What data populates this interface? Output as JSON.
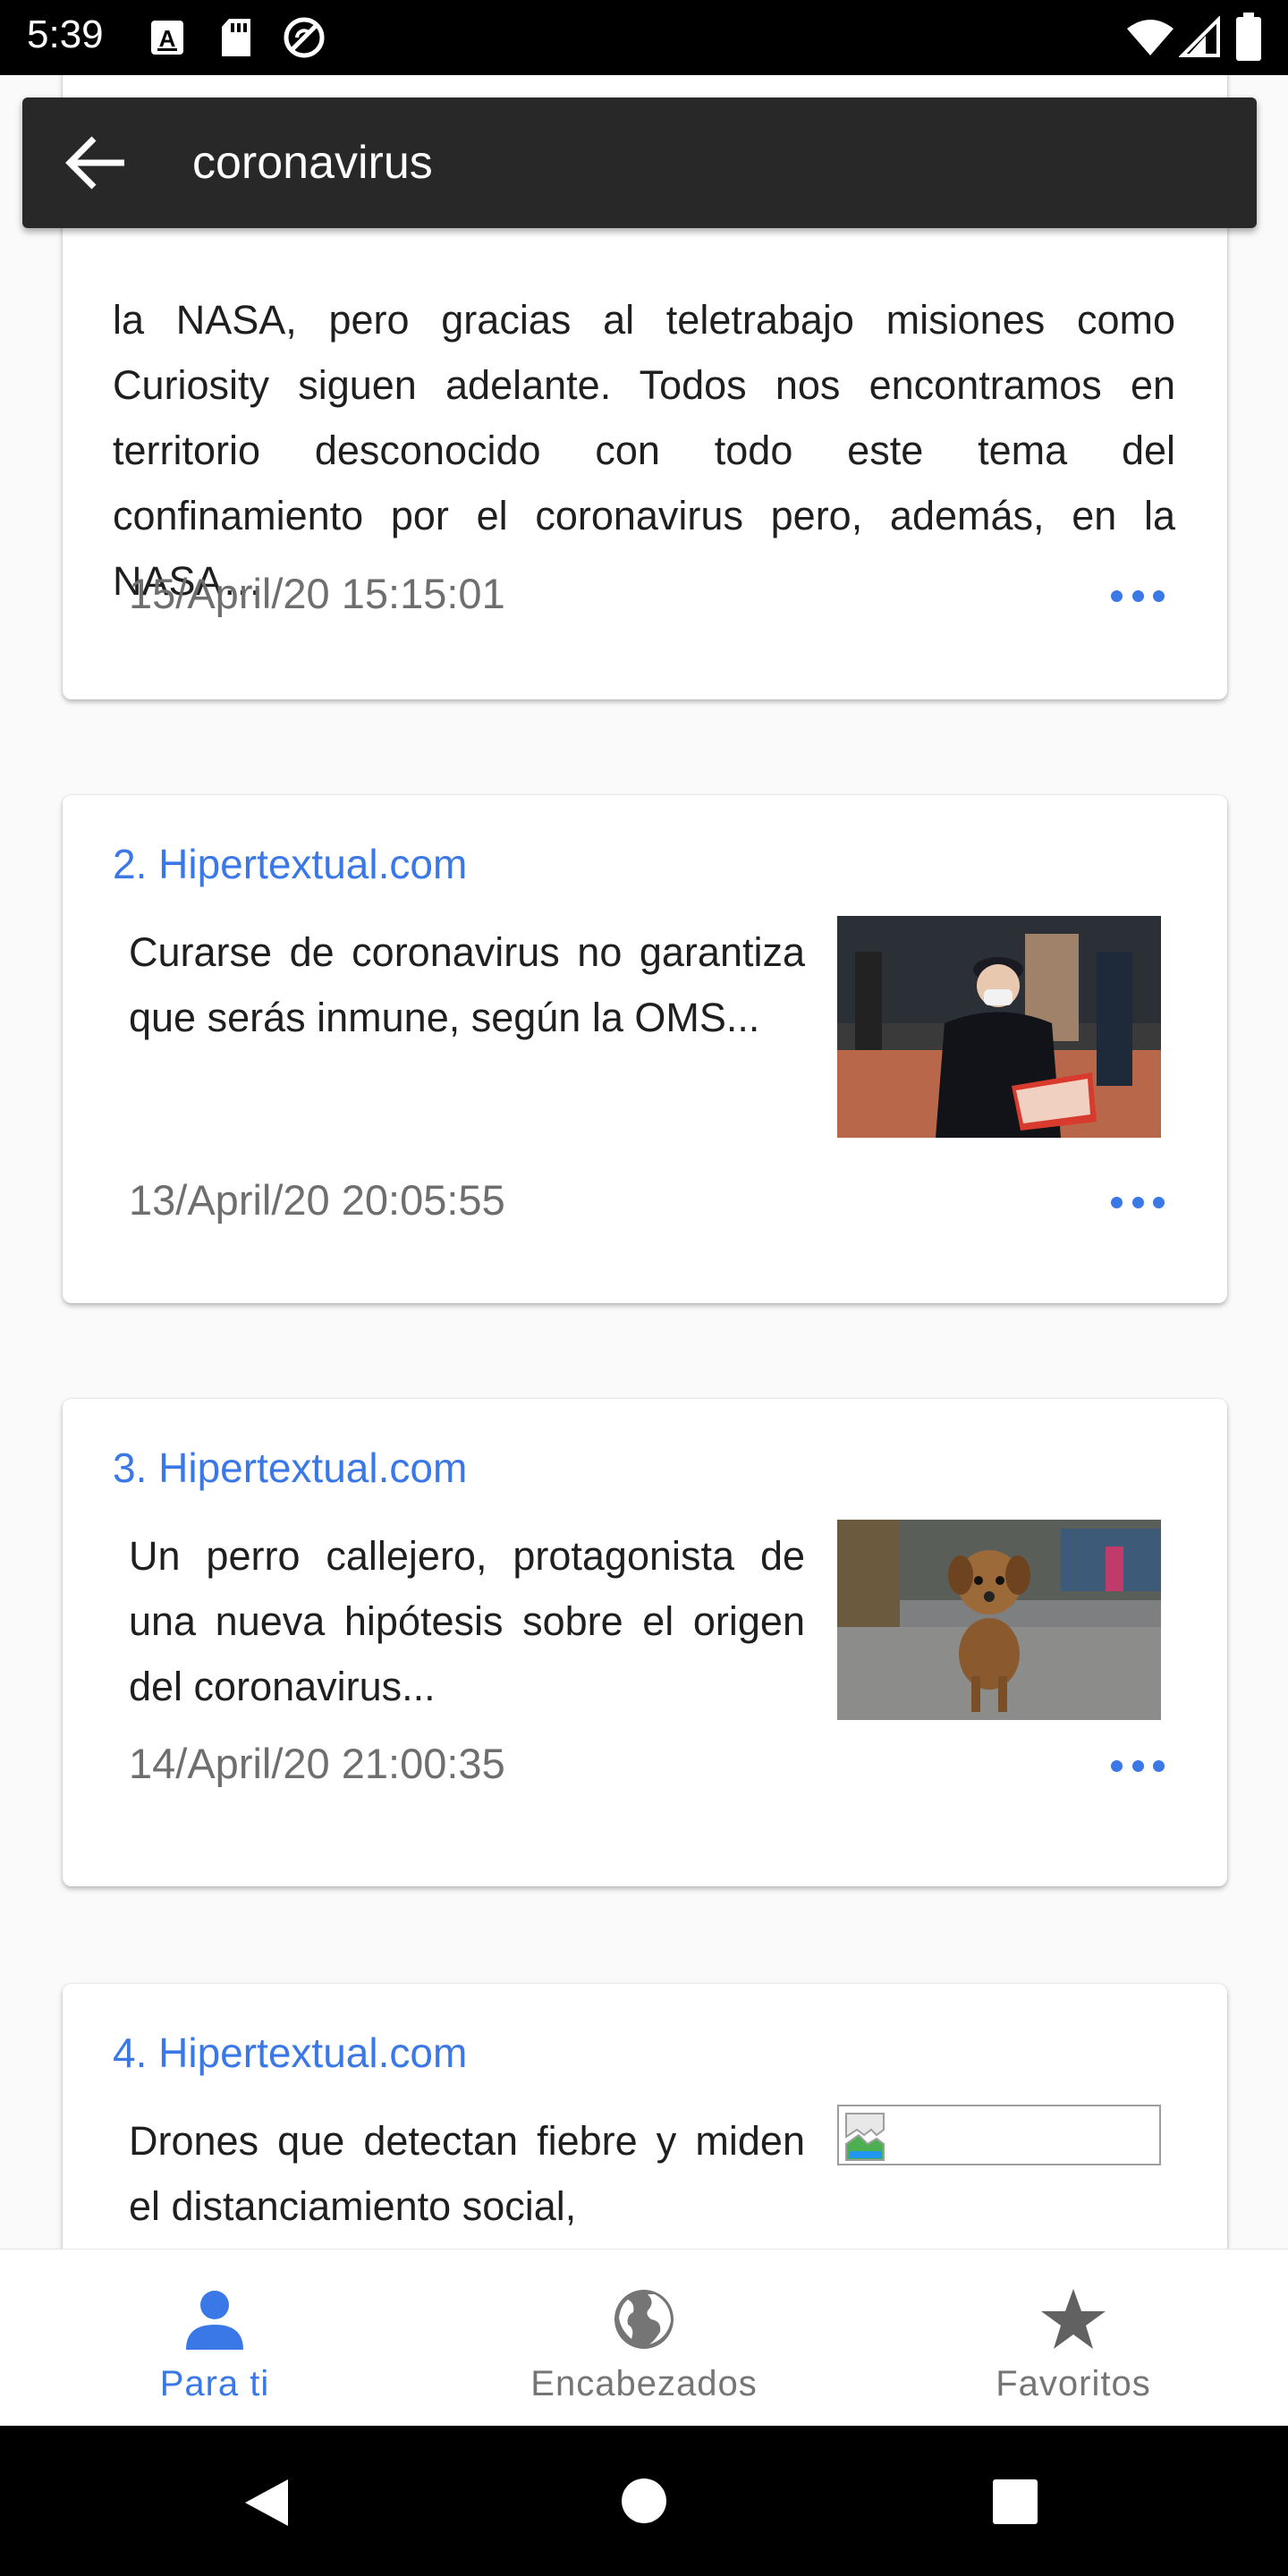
{
  "status_bar": {
    "time": "5:39",
    "icons": [
      "a-text-icon",
      "sd-card-icon",
      "no-sync-icon",
      "wifi-icon",
      "signal-icon",
      "battery-icon"
    ]
  },
  "search": {
    "query": "coronavirus"
  },
  "articles": [
    {
      "text": "la NASA, pero gracias al teletrabajo misiones como Curiosity siguen adelante. Todos nos encontramos en territorio desconocido con todo este tema del confinamiento por el coronavirus pero, además, en la NASA…",
      "date": "15/April/20 15:15:01"
    },
    {
      "source": "2. Hipertextual.com",
      "text": "Curarse de coronavirus no garantiza que serás inmune, según la OMS...",
      "date": "13/April/20 20:05:55",
      "image": "man-with-mask-photo"
    },
    {
      "source": "3. Hipertextual.com",
      "text": "Un perro callejero, protagonista de una nueva hipótesis sobre el origen del coronavirus...",
      "date": "14/April/20 21:00:35",
      "image": "stray-dog-photo"
    },
    {
      "source": "4. Hipertextual.com",
      "text": "Drones que detectan fiebre y miden el distanciamiento social,",
      "image": "broken-image"
    }
  ],
  "bottom_nav": [
    {
      "label": "Para ti",
      "icon": "person-icon",
      "active": true
    },
    {
      "label": "Encabezados",
      "icon": "globe-icon",
      "active": false
    },
    {
      "label": "Favoritos",
      "icon": "star-icon",
      "active": false
    }
  ],
  "colors": {
    "accent": "#3b78e7",
    "app_bar": "#282828",
    "inactive": "#757575"
  }
}
